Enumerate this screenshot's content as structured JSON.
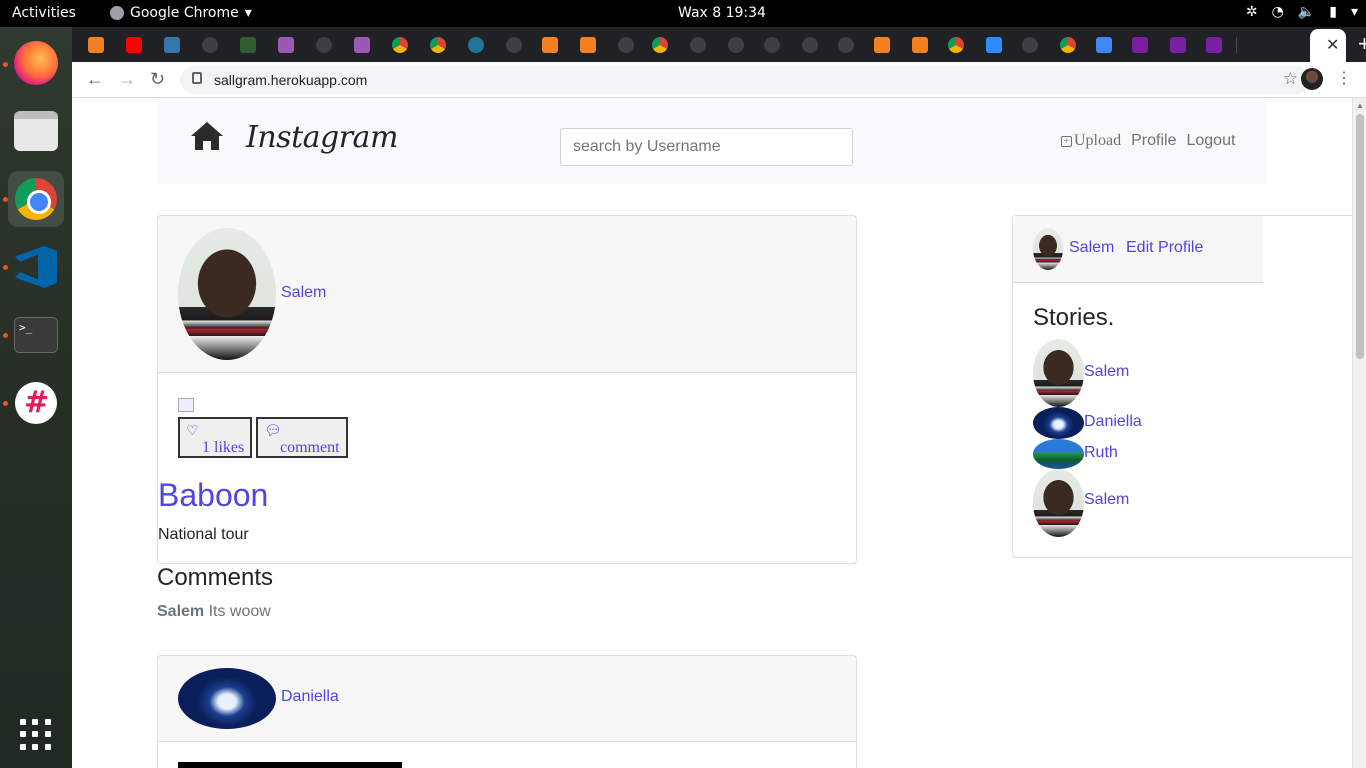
{
  "system": {
    "activities": "Activities",
    "app_name": "Google Chrome",
    "clock": "Wax 8  19:34"
  },
  "browser": {
    "url": "sallgram.herokuapp.com"
  },
  "navbar": {
    "brand": "Instagram",
    "search_placeholder": "search by Username",
    "upload": "Upload",
    "profile": "Profile",
    "logout": "Logout"
  },
  "post1": {
    "username": "Salem",
    "likes_label": "1 likes",
    "comment_label": "comment",
    "title": "Baboon",
    "caption": "National tour"
  },
  "comments": {
    "heading": "Comments",
    "items": [
      {
        "author": "Salem",
        "text": "Its woow"
      }
    ]
  },
  "post2": {
    "username": "Daniella"
  },
  "sidebar": {
    "username": "Salem",
    "edit_profile": "Edit Profile",
    "stories_heading": "Stories.",
    "stories": [
      {
        "name": "Salem",
        "avatar": "face"
      },
      {
        "name": "Daniella",
        "avatar": "shark"
      },
      {
        "name": "Ruth",
        "avatar": "island"
      },
      {
        "name": "Salem",
        "avatar": "face"
      }
    ]
  },
  "colors": {
    "link": "#4f46e5",
    "navbar_bg": "#f8f9fa"
  }
}
